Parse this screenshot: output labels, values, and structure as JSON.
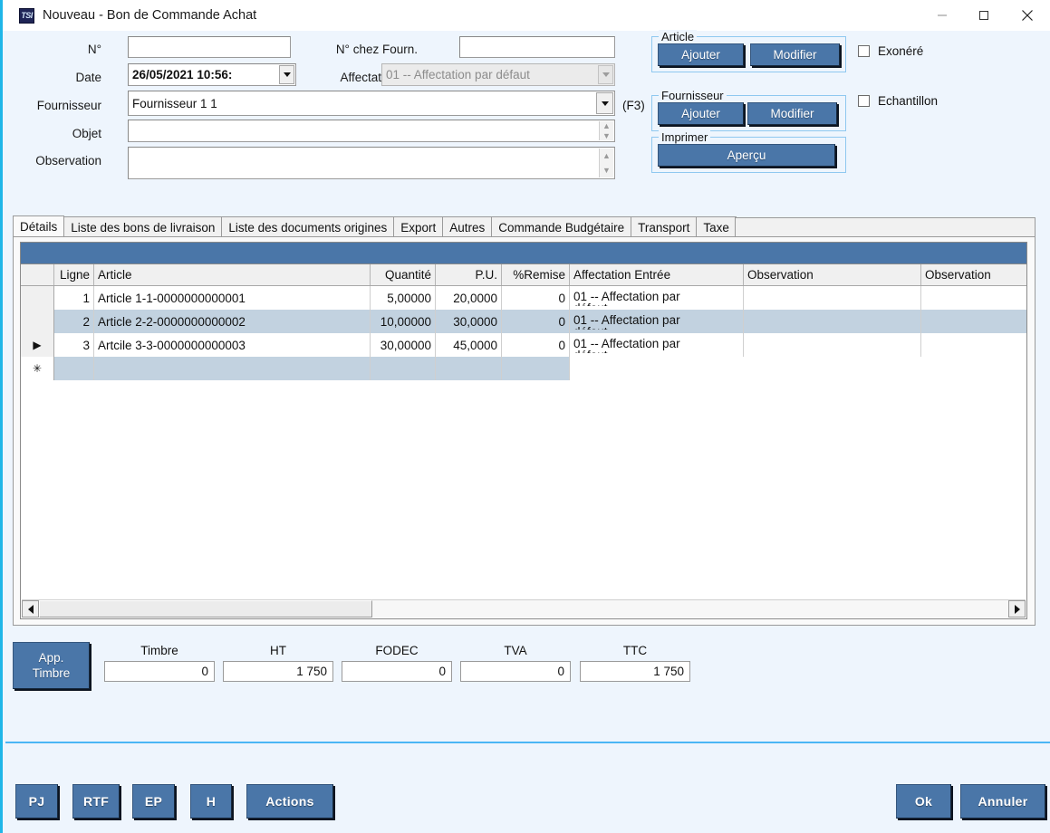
{
  "window": {
    "title": "Nouveau - Bon de Commande Achat",
    "app_icon_text": "TSI",
    "minimize_label": "minimize-icon",
    "maximize_label": "maximize-icon",
    "close_label": "close-icon"
  },
  "header": {
    "num_label": "N°",
    "num_value": "",
    "num_placeholder": "",
    "date_label": "Date",
    "date_value": "26/05/2021 10:56:",
    "fournisseur_label": "Fournisseur",
    "fournisseur_value": "Fournisseur 1 1",
    "fournisseur_hint": "(F3)",
    "objet_label": "Objet",
    "objet_value": "",
    "observation_label": "Observation",
    "observation_value": "",
    "num_fourn_label": "N° chez Fourn.",
    "num_fourn_value": "",
    "affectation_label": "Affectation",
    "affectation_value": "01 -- Affectation par défaut"
  },
  "groups": {
    "article": {
      "title": "Article",
      "add_label": "Ajouter",
      "edit_label": "Modifier"
    },
    "fournisseur": {
      "title": "Fournisseur",
      "add_label": "Ajouter",
      "edit_label": "Modifier"
    },
    "imprimer": {
      "title": "Imprimer",
      "preview_label": "Aperçu"
    }
  },
  "checkboxes": [
    {
      "label": "Exonéré",
      "checked": false
    },
    {
      "label": "Echantillon",
      "checked": false
    }
  ],
  "tabs": [
    {
      "label": "Détails",
      "active": true
    },
    {
      "label": "Liste des bons de livraison",
      "active": false
    },
    {
      "label": "Liste des documents origines",
      "active": false
    },
    {
      "label": "Export",
      "active": false
    },
    {
      "label": "Autres",
      "active": false
    },
    {
      "label": "Commande Budgétaire",
      "active": false
    },
    {
      "label": "Transport",
      "active": false
    },
    {
      "label": "Taxe",
      "active": false
    }
  ],
  "grid": {
    "columns": [
      "",
      "Ligne",
      "Article",
      "Quantité",
      "P.U.",
      "%Remise",
      "Affectation Entrée",
      "Observation",
      "Observation"
    ],
    "rows": [
      {
        "marker": "",
        "ligne": "1",
        "article": "Article 1-1-0000000000001",
        "quantite": "5,00000",
        "pu": "20,0000",
        "remise": "0",
        "affectation": "01 -- Affectation par",
        "affectation_line2": "défaut",
        "observation1": "",
        "observation2": ""
      },
      {
        "marker": "",
        "ligne": "2",
        "article": "Article 2-2-0000000000002",
        "quantite": "10,00000",
        "pu": "30,0000",
        "remise": "0",
        "affectation": "01 -- Affectation par",
        "affectation_line2": "défaut",
        "observation1": "",
        "observation2": ""
      },
      {
        "marker": "▶",
        "ligne": "3",
        "article": "Artcile 3-3-0000000000003",
        "quantite": "30,00000",
        "pu": "45,0000",
        "remise": "0",
        "affectation": "01 -- Affectation par",
        "affectation_line2": "défaut",
        "observation1": "",
        "observation2": ""
      }
    ],
    "new_row_marker": "✳"
  },
  "totals": {
    "app_timbre_line1": "App.",
    "app_timbre_line2": "Timbre",
    "fields": [
      {
        "label": "Timbre",
        "value": "0"
      },
      {
        "label": "HT",
        "value": "1 750"
      },
      {
        "label": "FODEC",
        "value": "0"
      },
      {
        "label": "TVA",
        "value": "0"
      },
      {
        "label": "TTC",
        "value": "1 750"
      }
    ]
  },
  "bottom_bar": {
    "left_buttons": [
      {
        "label": "PJ"
      },
      {
        "label": "RTF"
      },
      {
        "label": "EP"
      },
      {
        "label": "H"
      },
      {
        "label": "Actions"
      }
    ],
    "right_buttons": [
      {
        "label": "Ok"
      },
      {
        "label": "Annuler"
      }
    ]
  },
  "colors": {
    "accent_blue": "#4a76a8",
    "panel_bg": "#eef5fd",
    "separator_cyan": "#4ab6f5",
    "grid_alt_row": "#c2d2e0"
  }
}
